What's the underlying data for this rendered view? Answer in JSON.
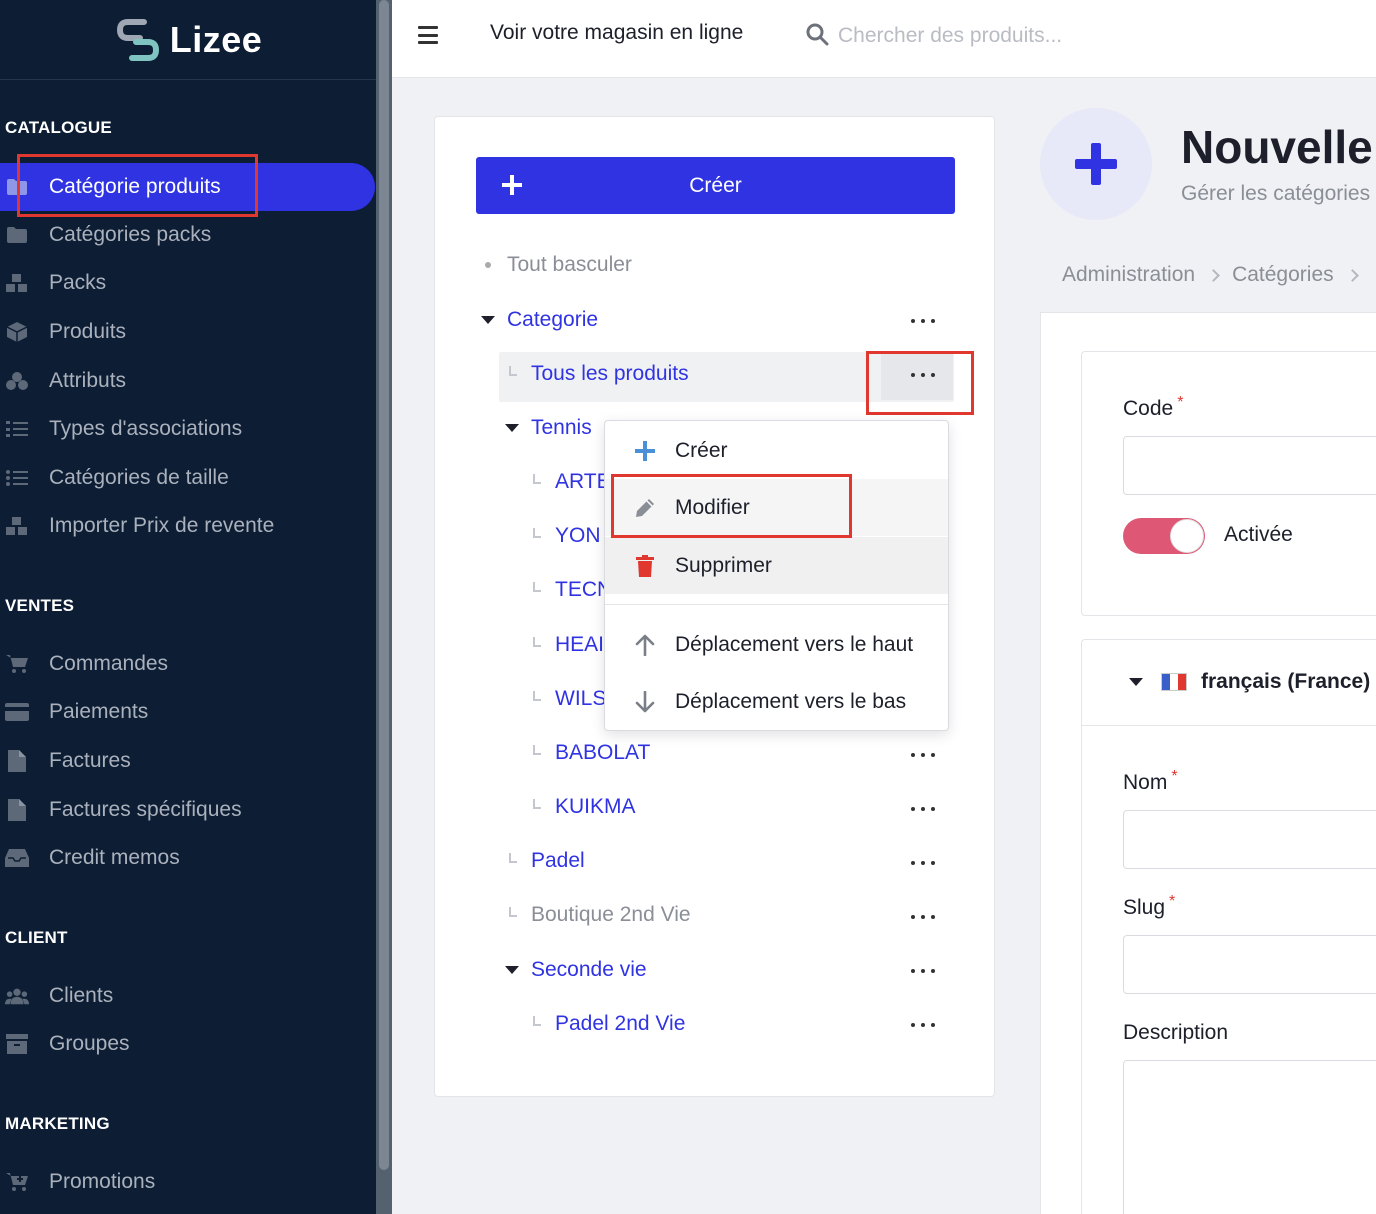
{
  "brand": {
    "name": "Lizee"
  },
  "sidebar": {
    "sections": [
      {
        "title": "CATALOGUE",
        "items": [
          {
            "label": "Catégorie produits",
            "icon": "folder-icon",
            "active": true
          },
          {
            "label": "Catégories packs",
            "icon": "folder-icon"
          },
          {
            "label": "Packs",
            "icon": "boxes-icon"
          },
          {
            "label": "Produits",
            "icon": "cube-icon"
          },
          {
            "label": "Attributs",
            "icon": "cubes-icon"
          },
          {
            "label": "Types d'associations",
            "icon": "list-ol-icon"
          },
          {
            "label": "Catégories de taille",
            "icon": "list-icon"
          },
          {
            "label": "Importer Prix de revente",
            "icon": "boxes-icon"
          }
        ]
      },
      {
        "title": "VENTES",
        "items": [
          {
            "label": "Commandes",
            "icon": "cart-icon"
          },
          {
            "label": "Paiements",
            "icon": "credit-card-icon"
          },
          {
            "label": "Factures",
            "icon": "file-icon"
          },
          {
            "label": "Factures spécifiques",
            "icon": "file-icon"
          },
          {
            "label": "Credit memos",
            "icon": "inbox-icon"
          }
        ]
      },
      {
        "title": "CLIENT",
        "items": [
          {
            "label": "Clients",
            "icon": "users-icon"
          },
          {
            "label": "Groupes",
            "icon": "archive-icon"
          }
        ]
      },
      {
        "title": "MARKETING",
        "items": [
          {
            "label": "Promotions",
            "icon": "cart-plus-icon"
          }
        ]
      }
    ]
  },
  "topbar": {
    "shop_link": "Voir votre magasin en ligne",
    "search_placeholder": "Chercher des produits..."
  },
  "tree": {
    "create_label": "Créer",
    "toggle_all": "Tout basculer",
    "nodes": [
      {
        "label": "Categorie",
        "level": 0,
        "expanded": true
      },
      {
        "label": "Tous les produits",
        "level": 1
      },
      {
        "label": "Tennis",
        "level": 1,
        "expanded": true
      },
      {
        "label": "ARTE",
        "level": 2
      },
      {
        "label": "YON",
        "level": 2
      },
      {
        "label": "TECN",
        "level": 2
      },
      {
        "label": "HEAI",
        "level": 2
      },
      {
        "label": "WILS",
        "level": 2
      },
      {
        "label": "BABOLAT",
        "level": 2
      },
      {
        "label": "KUIKMA",
        "level": 2
      },
      {
        "label": "Padel",
        "level": 1
      },
      {
        "label": "Boutique 2nd Vie",
        "level": 1,
        "disabled": true
      },
      {
        "label": "Seconde vie",
        "level": 1,
        "expanded": true
      },
      {
        "label": "Padel 2nd Vie",
        "level": 2
      }
    ]
  },
  "context_menu": {
    "items": [
      {
        "label": "Créer",
        "icon": "plus-icon"
      },
      {
        "label": "Modifier",
        "icon": "pencil-icon"
      },
      {
        "label": "Supprimer",
        "icon": "trash-icon"
      },
      {
        "label": "Déplacement vers le haut",
        "icon": "arrow-up-icon"
      },
      {
        "label": "Déplacement vers le bas",
        "icon": "arrow-down-icon"
      }
    ]
  },
  "page": {
    "title": "Nouvelle c",
    "subtitle": "Gérer les catégories",
    "breadcrumb": [
      "Administration",
      "Catégories"
    ]
  },
  "form": {
    "code_label": "Code",
    "enabled_label": "Activée",
    "language_label": "français (France)",
    "name_label": "Nom",
    "slug_label": "Slug",
    "description_label": "Description",
    "required_mark": "*"
  },
  "colors": {
    "sidebar_bg": "#0c1d34",
    "accent": "#2f33e2",
    "highlight_box": "#e0372f",
    "toggle_on": "#de5876",
    "danger": "#e0372f",
    "icon_blue": "#4a90d9"
  }
}
